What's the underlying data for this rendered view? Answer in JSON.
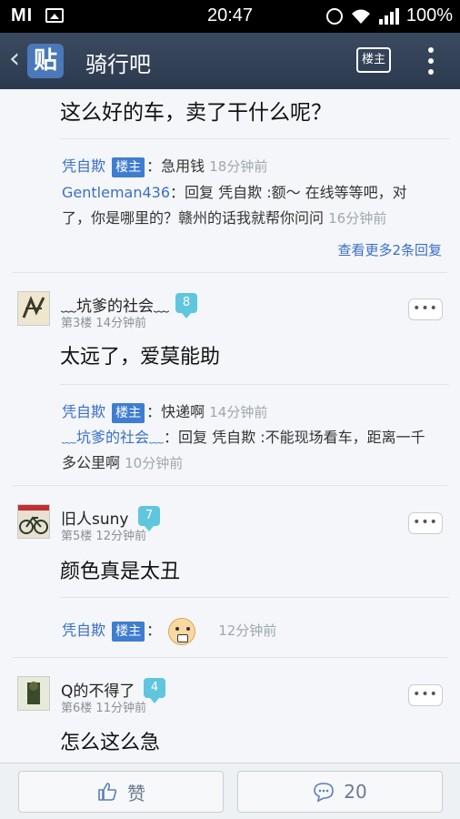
{
  "status_bar": {
    "carrier": "MI",
    "time": "20:47",
    "battery": "100%"
  },
  "title_bar": {
    "back_icon": "chevron-left-icon",
    "logo_text": "贴",
    "title": "骑行吧",
    "louzhu_button": "楼主"
  },
  "top_post": {
    "text": "这么好的车，卖了干什么呢？",
    "replies": [
      {
        "user": "凭自欺",
        "badge": "楼主",
        "sep": "：",
        "text": "急用钱",
        "time": "18分钟前"
      },
      {
        "user": "Gentleman436",
        "sep": "：",
        "text": "回复 凭自欺 :额～ 在线等等吧，对了，你是哪里的？赣州的话我就帮你问问",
        "time": "16分钟前"
      }
    ],
    "see_more": "查看更多2条回复"
  },
  "floors": [
    {
      "name": "﹏坑爹的社会﹏",
      "level": "8",
      "floor": "第3楼",
      "time": "14分钟前",
      "text": "太远了，爱莫能助",
      "replies": [
        {
          "user": "凭自欺",
          "badge": "楼主",
          "sep": "：",
          "text": "快递啊",
          "time": "14分钟前"
        },
        {
          "user": "﹏坑爹的社会﹏",
          "sep": "：",
          "text": "回复 凭自欺 :不能现场看车，距离一千多公里啊",
          "time": "10分钟前"
        }
      ]
    },
    {
      "name": "旧人suny",
      "level": "7",
      "floor": "第5楼",
      "time": "12分钟前",
      "text": "颜色真是太丑",
      "replies": [
        {
          "user": "凭自欺",
          "badge": "楼主",
          "sep": "：",
          "text": "",
          "time": "12分钟前"
        }
      ]
    },
    {
      "name": "Q的不得了",
      "level": "4",
      "floor": "第6楼",
      "time": "11分钟前",
      "text": "怎么这么急"
    }
  ],
  "bottom_bar": {
    "like_label": "赞",
    "comment_count": "20"
  },
  "colors": {
    "title_bar": "#34435a",
    "link_blue": "#3b6fc4",
    "badge_blue": "#3f7dd0",
    "level_teal": "#5fc6de"
  }
}
